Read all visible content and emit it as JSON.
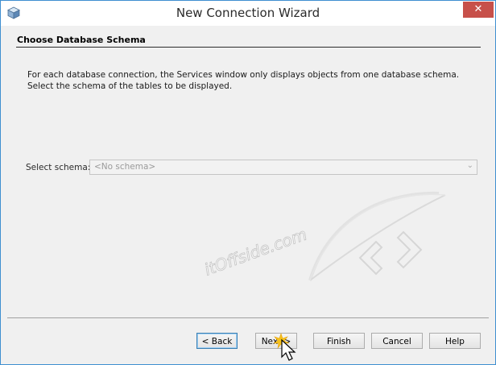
{
  "window": {
    "title": "New Connection Wizard",
    "close_glyph": "✕",
    "icon": "app-cube-icon"
  },
  "section": {
    "title": "Choose Database Schema"
  },
  "description": {
    "line1": "For each database connection, the Services window only displays objects from one database schema.",
    "line2": "Select the schema of the tables to be displayed."
  },
  "schema": {
    "label": "Select schema:",
    "value": "<No schema>",
    "enabled": false
  },
  "watermark": {
    "text": "itOffside.com"
  },
  "buttons": {
    "back": "< Back",
    "next": "Next >",
    "finish": "Finish",
    "cancel": "Cancel",
    "help": "Help"
  },
  "colors": {
    "window_border": "#3f8fd0",
    "close_button": "#c7504a",
    "dialog_background": "#f0f0f0",
    "focused_button_border": "#3c7fb1"
  }
}
